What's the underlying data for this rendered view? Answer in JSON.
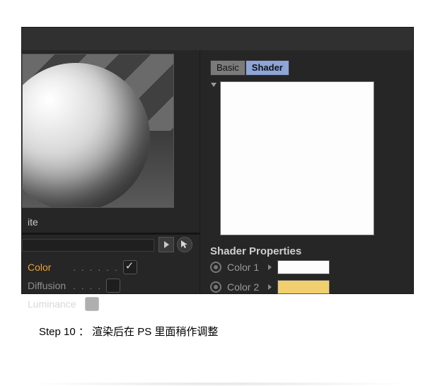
{
  "left": {
    "material_name_suffix": "ite",
    "attributes": [
      {
        "label": "Color",
        "dots": ". . . . . .",
        "checked": true,
        "active": true
      },
      {
        "label": "Diffusion",
        "dots": ". . . .",
        "checked": false,
        "active": false
      },
      {
        "label": "Luminance",
        "dots": "",
        "checked": false,
        "active": false
      }
    ]
  },
  "right": {
    "tabs": {
      "basic": "Basic",
      "shader": "Shader"
    },
    "section_title": "Shader Properties",
    "rows": [
      {
        "label": "Color 1",
        "swatch": "#fdfdfd"
      },
      {
        "label": "Color 2",
        "swatch": "#f1cf6f"
      }
    ]
  },
  "caption": "Step 10 ： 渲染后在 PS 里面稍作调整"
}
